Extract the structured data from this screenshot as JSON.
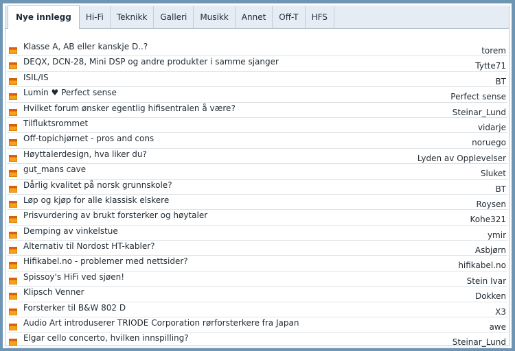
{
  "tabs": [
    {
      "label": "Nye innlegg",
      "active": true
    },
    {
      "label": "Hi-Fi",
      "active": false
    },
    {
      "label": "Teknikk",
      "active": false
    },
    {
      "label": "Galleri",
      "active": false
    },
    {
      "label": "Musikk",
      "active": false
    },
    {
      "label": "Annet",
      "active": false
    },
    {
      "label": "Off-T",
      "active": false
    },
    {
      "label": "HFS",
      "active": false
    }
  ],
  "threads": [
    {
      "title": "Klasse A, AB eller kanskje D..?",
      "author": "torem"
    },
    {
      "title": "DEQX, DCN-28, Mini DSP og andre produkter i samme sjanger",
      "author": "Tytte71"
    },
    {
      "title": "ISIL/IS",
      "author": "BT"
    },
    {
      "title": "Lumin ♥ Perfect sense",
      "author": "Perfect sense"
    },
    {
      "title": "Hvilket forum ønsker egentlig hifisentralen å være?",
      "author": "Steinar_Lund"
    },
    {
      "title": "Tilfluktsrommet",
      "author": "vidarje"
    },
    {
      "title": "Off-topichjørnet - pros and cons",
      "author": "noruego"
    },
    {
      "title": "Høyttalerdesign, hva liker du?",
      "author": "Lyden av Opplevelser"
    },
    {
      "title": "gut_mans cave",
      "author": "Sluket"
    },
    {
      "title": "Dårlig kvalitet på norsk grunnskole?",
      "author": "BT"
    },
    {
      "title": "Løp og kjøp for alle klassisk elskere",
      "author": "Roysen"
    },
    {
      "title": "Prisvurdering av brukt forsterker og høytaler",
      "author": "Kohe321"
    },
    {
      "title": "Demping av vinkelstue",
      "author": "ymir"
    },
    {
      "title": "Alternativ til Nordost HT-kabler?",
      "author": "Asbjørn"
    },
    {
      "title": "Hifikabel.no - problemer med nettsider?",
      "author": "hifikabel.no"
    },
    {
      "title": "Spissoy's HiFi ved sjøen!",
      "author": "Stein Ivar"
    },
    {
      "title": "Klipsch Venner",
      "author": "Dokken"
    },
    {
      "title": "Forsterker til B&W 802 D",
      "author": "X3"
    },
    {
      "title": "Audio Art introduserer TRIODE Corporation rørforsterkere fra Japan",
      "author": "awe"
    },
    {
      "title": "Elgar cello concerto, hvilken innspilling?",
      "author": "Steinar_Lund"
    }
  ],
  "colors": {
    "frame_border": "#6f95b4",
    "tab_bar_bg": "#e5ecf3",
    "folder_body": "#f3a21a",
    "folder_tab": "#e05a10",
    "text": "#1f2a33"
  },
  "icons": {
    "thread": "folder-icon"
  }
}
